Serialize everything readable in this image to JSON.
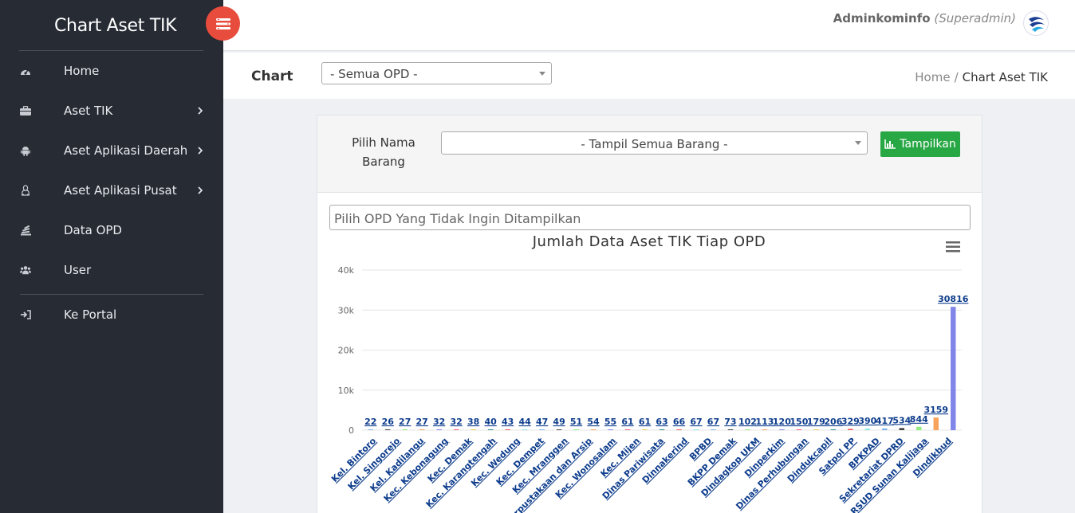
{
  "app": {
    "title": "Chart Aset TIK"
  },
  "sidebar": {
    "items": [
      {
        "label": "Home",
        "icon": "dashboard-icon",
        "chevron": false
      },
      {
        "label": "Aset TIK",
        "icon": "briefcase-icon",
        "chevron": true
      },
      {
        "label": "Aset Aplikasi Daerah",
        "icon": "android-icon",
        "chevron": true
      },
      {
        "label": "Aset Aplikasi Pusat",
        "icon": "linux-icon",
        "chevron": true
      },
      {
        "label": "Data OPD",
        "icon": "stack-icon",
        "chevron": false
      },
      {
        "label": "User",
        "icon": "users-icon",
        "chevron": false
      }
    ],
    "portal": {
      "label": "Ke Portal",
      "icon": "sign-in-icon"
    }
  },
  "topbar": {
    "username": "Adminkominfo",
    "role": "(Superadmin)"
  },
  "header": {
    "title": "Chart",
    "opd_select": "- Semua OPD -",
    "breadcrumb": {
      "home": "Home",
      "separator": "/",
      "current": "Chart Aset TIK"
    }
  },
  "filter": {
    "label_line1": "Pilih Nama",
    "label_line2": "Barang",
    "barang_select": "- Tampil Semua Barang -",
    "button_label": "Tampilkan",
    "exclude_placeholder": "Pilih OPD Yang Tidak Ingin Ditampilkan"
  },
  "colors": {
    "accent_green": "#28a745",
    "toggle_red": "#e84c3d",
    "sidebar_bg": "#272b34",
    "link_blue": "#0d3c8c"
  },
  "chart_data": {
    "type": "bar",
    "title": "Jumlah Data Aset TIK Tiap OPD",
    "ylim": [
      0,
      40000
    ],
    "yticks": [
      "0",
      "10k",
      "20k",
      "30k",
      "40k"
    ],
    "xlabel": "",
    "ylabel": "",
    "grid": true,
    "categories": [
      "Kel. Bintoro",
      "Kel. Singorejo",
      "Kel. Kadilangu",
      "Kec. Kebonagung",
      "Kec. Demak",
      "Kec. Karangtengah",
      "Kec. Wedung",
      "Kec. Dempet",
      "Kec. Mranggen",
      "Perpustakaan dan Arsip",
      "Kec. Wonosalam",
      "Kec. Mijen",
      "Dinas Pariwisata",
      "Dinnakerind",
      "BPBD",
      "BKPP Demak",
      "Dindagkop UKM",
      "Dinperkim",
      "Dinas Perhubungan",
      "Dindukcapil",
      "Satpol PP",
      "BPKPAD",
      "Sekretariat DPRD",
      "RSUD Sunan Kalijaga",
      "Dindikbud"
    ],
    "values": [
      22,
      26,
      27,
      27,
      32,
      32,
      38,
      40,
      43,
      44,
      47,
      49,
      51,
      54,
      55,
      61,
      61,
      63,
      66,
      67,
      67,
      73,
      102,
      113,
      120,
      150,
      179,
      206,
      329,
      390,
      417,
      534,
      844,
      3159,
      30816
    ],
    "bar_colors": [
      "#7cb5ec",
      "#434348",
      "#90ed7d",
      "#f7a35c",
      "#8085e9",
      "#f15c80",
      "#e4d354",
      "#2b908f",
      "#f45b5b",
      "#91e8e1"
    ]
  }
}
